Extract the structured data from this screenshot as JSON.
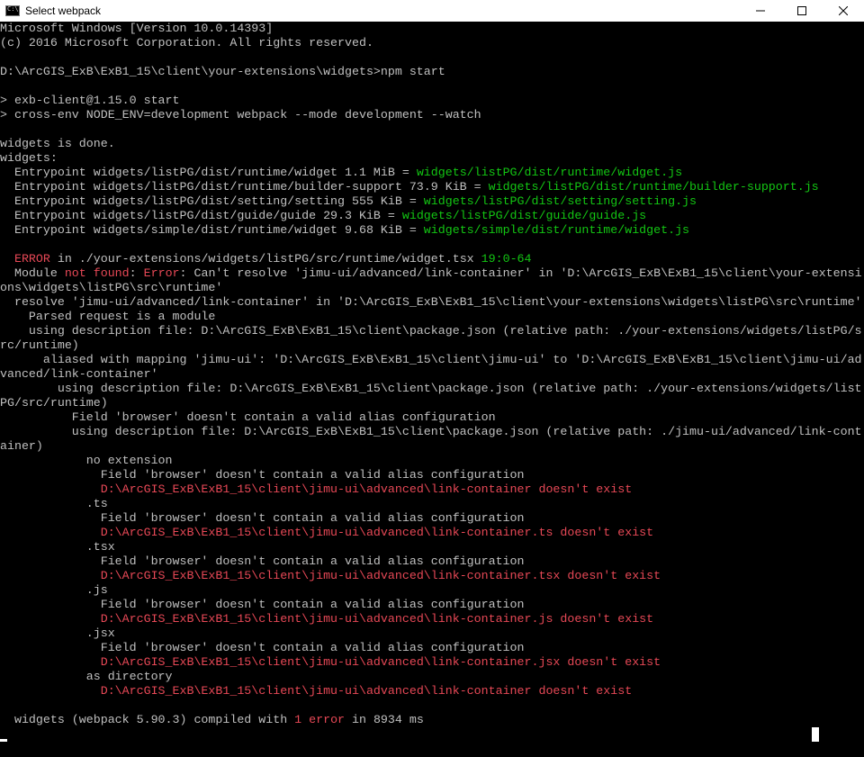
{
  "window": {
    "title": "Select webpack",
    "icon": "console-icon",
    "controls": [
      "minimize-icon",
      "maximize-icon",
      "close-icon"
    ]
  },
  "colors": {
    "text": "#c0c0c0",
    "green": "#13c613",
    "red": "#e74856",
    "background": "#000000"
  },
  "console": {
    "lines": [
      [
        {
          "t": "Microsoft Windows [Version 10.0.14393]"
        }
      ],
      [
        {
          "t": "(c) 2016 Microsoft Corporation. All rights reserved."
        }
      ],
      [
        {
          "t": ""
        }
      ],
      [
        {
          "t": "D:\\ArcGIS_ExB\\ExB1_15\\client\\your-extensions\\widgets>npm start"
        }
      ],
      [
        {
          "t": ""
        }
      ],
      [
        {
          "t": "> exb-client@1.15.0 start"
        }
      ],
      [
        {
          "t": "> cross-env NODE_ENV=development webpack --mode development --watch"
        }
      ],
      [
        {
          "t": ""
        }
      ],
      [
        {
          "t": "widgets is done."
        }
      ],
      [
        {
          "t": "widgets:"
        }
      ],
      [
        {
          "t": "  Entrypoint widgets/listPG/dist/runtime/widget 1.1 MiB = "
        },
        {
          "t": "widgets/listPG/dist/runtime/widget.js",
          "c": "green"
        }
      ],
      [
        {
          "t": "  Entrypoint widgets/listPG/dist/runtime/builder-support 73.9 KiB = "
        },
        {
          "t": "widgets/listPG/dist/runtime/builder-support.js",
          "c": "green"
        }
      ],
      [
        {
          "t": "  Entrypoint widgets/listPG/dist/setting/setting 555 KiB = "
        },
        {
          "t": "widgets/listPG/dist/setting/setting.js",
          "c": "green"
        }
      ],
      [
        {
          "t": "  Entrypoint widgets/listPG/dist/guide/guide 29.3 KiB = "
        },
        {
          "t": "widgets/listPG/dist/guide/guide.js",
          "c": "green"
        }
      ],
      [
        {
          "t": "  Entrypoint widgets/simple/dist/runtime/widget 9.68 KiB = "
        },
        {
          "t": "widgets/simple/dist/runtime/widget.js",
          "c": "green"
        }
      ],
      [
        {
          "t": ""
        }
      ],
      [
        {
          "t": "  "
        },
        {
          "t": "ERROR",
          "c": "red"
        },
        {
          "t": " in ./your-extensions/widgets/listPG/src/runtime/widget.tsx "
        },
        {
          "t": "19:0-64",
          "c": "green"
        }
      ],
      [
        {
          "t": "  Module "
        },
        {
          "t": "not found",
          "c": "red"
        },
        {
          "t": ": "
        },
        {
          "t": "Error",
          "c": "red"
        },
        {
          "t": ": Can't resolve 'jimu-ui/advanced/link-container' in 'D:\\ArcGIS_ExB\\ExB1_15\\client\\your-extensi"
        }
      ],
      [
        {
          "t": "ons\\widgets\\listPG\\src\\runtime'"
        }
      ],
      [
        {
          "t": "  resolve 'jimu-ui/advanced/link-container' in 'D:\\ArcGIS_ExB\\ExB1_15\\client\\your-extensions\\widgets\\listPG\\src\\runtime'"
        }
      ],
      [
        {
          "t": "    Parsed request is a module"
        }
      ],
      [
        {
          "t": "    using description file: D:\\ArcGIS_ExB\\ExB1_15\\client\\package.json (relative path: ./your-extensions/widgets/listPG/s"
        }
      ],
      [
        {
          "t": "rc/runtime)"
        }
      ],
      [
        {
          "t": "      aliased with mapping 'jimu-ui': 'D:\\ArcGIS_ExB\\ExB1_15\\client\\jimu-ui' to 'D:\\ArcGIS_ExB\\ExB1_15\\client\\jimu-ui/ad"
        }
      ],
      [
        {
          "t": "vanced/link-container'"
        }
      ],
      [
        {
          "t": "        using description file: D:\\ArcGIS_ExB\\ExB1_15\\client\\package.json (relative path: ./your-extensions/widgets/list"
        }
      ],
      [
        {
          "t": "PG/src/runtime)"
        }
      ],
      [
        {
          "t": "          Field 'browser' doesn't contain a valid alias configuration"
        }
      ],
      [
        {
          "t": "          using description file: D:\\ArcGIS_ExB\\ExB1_15\\client\\package.json (relative path: ./jimu-ui/advanced/link-cont"
        }
      ],
      [
        {
          "t": "ainer)"
        }
      ],
      [
        {
          "t": "            no extension"
        }
      ],
      [
        {
          "t": "              Field 'browser' doesn't contain a valid alias configuration"
        }
      ],
      [
        {
          "t": "              "
        },
        {
          "t": "D:\\ArcGIS_ExB\\ExB1_15\\client\\jimu-ui\\advanced\\link-container doesn't exist",
          "c": "red"
        }
      ],
      [
        {
          "t": "            .ts"
        }
      ],
      [
        {
          "t": "              Field 'browser' doesn't contain a valid alias configuration"
        }
      ],
      [
        {
          "t": "              "
        },
        {
          "t": "D:\\ArcGIS_ExB\\ExB1_15\\client\\jimu-ui\\advanced\\link-container.ts doesn't exist",
          "c": "red"
        }
      ],
      [
        {
          "t": "            .tsx"
        }
      ],
      [
        {
          "t": "              Field 'browser' doesn't contain a valid alias configuration"
        }
      ],
      [
        {
          "t": "              "
        },
        {
          "t": "D:\\ArcGIS_ExB\\ExB1_15\\client\\jimu-ui\\advanced\\link-container.tsx doesn't exist",
          "c": "red"
        }
      ],
      [
        {
          "t": "            .js"
        }
      ],
      [
        {
          "t": "              Field 'browser' doesn't contain a valid alias configuration"
        }
      ],
      [
        {
          "t": "              "
        },
        {
          "t": "D:\\ArcGIS_ExB\\ExB1_15\\client\\jimu-ui\\advanced\\link-container.js doesn't exist",
          "c": "red"
        }
      ],
      [
        {
          "t": "            .jsx"
        }
      ],
      [
        {
          "t": "              Field 'browser' doesn't contain a valid alias configuration"
        }
      ],
      [
        {
          "t": "              "
        },
        {
          "t": "D:\\ArcGIS_ExB\\ExB1_15\\client\\jimu-ui\\advanced\\link-container.jsx doesn't exist",
          "c": "red"
        }
      ],
      [
        {
          "t": "            as directory"
        }
      ],
      [
        {
          "t": "              "
        },
        {
          "t": "D:\\ArcGIS_ExB\\ExB1_15\\client\\jimu-ui\\advanced\\link-container doesn't exist",
          "c": "red"
        }
      ],
      [
        {
          "t": ""
        }
      ],
      [
        {
          "t": "  widgets (webpack 5.90.3) compiled with "
        },
        {
          "t": "1 error",
          "c": "red"
        },
        {
          "t": " in 8934 ms"
        }
      ]
    ]
  }
}
